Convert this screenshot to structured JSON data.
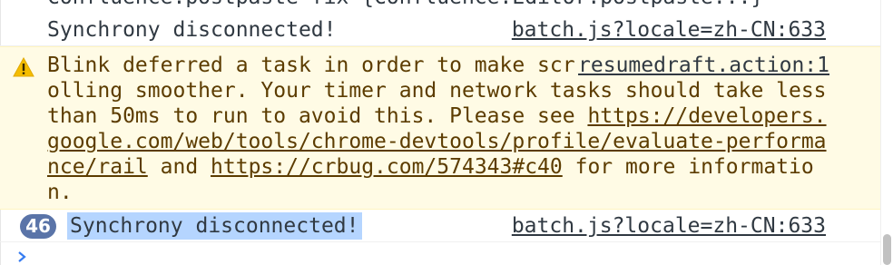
{
  "console": {
    "clipped_top_text": "Confluence.postpaste fix    {Confluence.Editor.postpaste...}",
    "messages": [
      {
        "text": "Synchrony disconnected!",
        "source": "batch.js?locale=zh-CN:633"
      },
      {
        "level": "warning",
        "icon": "warning-icon",
        "text_part1": "Blink deferred a task in order to make scrolling smoother. Your timer and network tasks should take less than 50ms to run to avoid this. Please see ",
        "link1": "https://developers.google.com/web/tools/chrome-devtools/profile/evaluate-performance/rail",
        "text_part2": " and ",
        "link2": "https://crbug.com/574343#c40",
        "text_part3": " for more information.",
        "source": "resumedraft.action:1"
      },
      {
        "repeat_count": "46",
        "text": "Synchrony disconnected!",
        "source": "batch.js?locale=zh-CN:633",
        "selected": true
      }
    ],
    "prompt_icon": "chevron-right-icon"
  },
  "colors": {
    "warning_background": "#fffbe5",
    "warning_text": "#5c3c00",
    "warning_icon": "#f4bd00",
    "badge": "#5a74a8",
    "selection": "#b5d5ff",
    "prompt": "#367cf1"
  }
}
